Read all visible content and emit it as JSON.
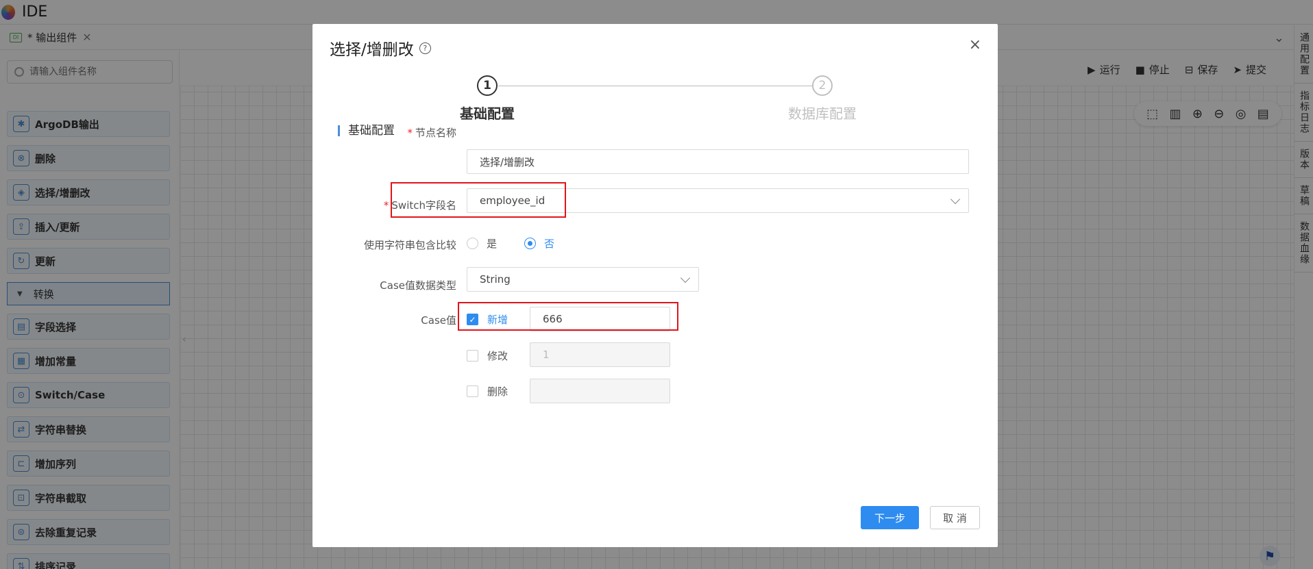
{
  "app": {
    "title": "IDE",
    "tab": {
      "type": "DI",
      "label": "* 输出组件",
      "close": "✕"
    },
    "search_placeholder": "请输入组件名称",
    "components": [
      {
        "label": "ArgoDB输出",
        "icon": "✱"
      },
      {
        "label": "删除",
        "icon": "⊗"
      },
      {
        "label": "选择/增删改",
        "icon": "◈"
      },
      {
        "label": "插入/更新",
        "icon": "⇪"
      },
      {
        "label": "更新",
        "icon": "↻"
      }
    ],
    "group": "转换",
    "group_arrow": "▼",
    "transform_components": [
      {
        "label": "字段选择",
        "icon": "▤"
      },
      {
        "label": "增加常量",
        "icon": "▦"
      },
      {
        "label": "Switch/Case",
        "icon": "⊙"
      },
      {
        "label": "字符串替换",
        "icon": "⇄"
      },
      {
        "label": "增加序列",
        "icon": "⊏"
      },
      {
        "label": "字符串截取",
        "icon": "⊡"
      },
      {
        "label": "去除重复记录",
        "icon": "⊜"
      },
      {
        "label": "排序记录",
        "icon": "⇅"
      }
    ],
    "run_actions": [
      {
        "label": "运行",
        "icon": "▶"
      },
      {
        "label": "停止",
        "icon": "■"
      },
      {
        "label": "保存",
        "icon": "⊟"
      },
      {
        "label": "提交",
        "icon": "➤"
      }
    ],
    "right_rail": [
      "通用配置",
      "指标日志",
      "版本",
      "草稿",
      "数据血缘"
    ]
  },
  "modal": {
    "title": "选择/增删改",
    "close": "×",
    "steps": [
      {
        "num": "1",
        "label": "基础配置"
      },
      {
        "num": "2",
        "label": "数据库配置"
      }
    ],
    "section": "基础配置",
    "node_name": {
      "label": "节点名称",
      "value": "选择/增删改"
    },
    "switch_field": {
      "label": "Switch字段名",
      "value": "employee_id"
    },
    "string_compare": {
      "label": "使用字符串包含比较",
      "yes": "是",
      "no": "否",
      "selected": "否"
    },
    "case_type": {
      "label": "Case值数据类型",
      "value": "String"
    },
    "case_values": {
      "label": "Case值",
      "rows": [
        {
          "label": "新增",
          "checked": true,
          "value": "666",
          "placeholder": ""
        },
        {
          "label": "修改",
          "checked": false,
          "value": "",
          "placeholder": "1"
        },
        {
          "label": "删除",
          "checked": false,
          "value": "",
          "placeholder": ""
        }
      ]
    },
    "next_button": "下一步",
    "cancel_button": "取 消"
  }
}
